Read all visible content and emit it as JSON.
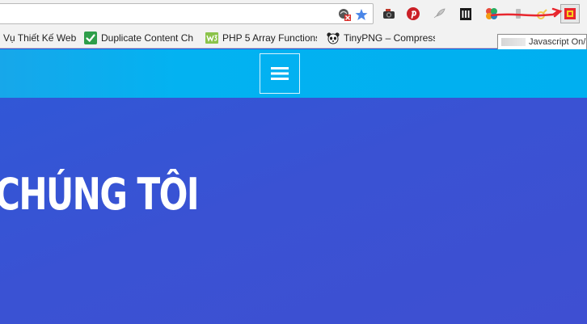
{
  "browser": {
    "bookmarks": [
      {
        "label": "Vụ Thiết Kế Web",
        "icon": "none"
      },
      {
        "label": "Duplicate Content Ch",
        "icon": "green-check-icon"
      },
      {
        "label": "PHP 5 Array Functions",
        "icon": "w3-icon"
      },
      {
        "label": "TinyPNG – Compress",
        "icon": "panda-icon"
      }
    ],
    "tooltip": "Javascript On/",
    "colors": {
      "accent_red": "#e8262e",
      "star_blue": "#4a86e8"
    }
  },
  "page": {
    "hero_title": "CHÚNG TÔI",
    "colors": {
      "header": "#00aff0",
      "hero": "#3a52d3"
    }
  }
}
